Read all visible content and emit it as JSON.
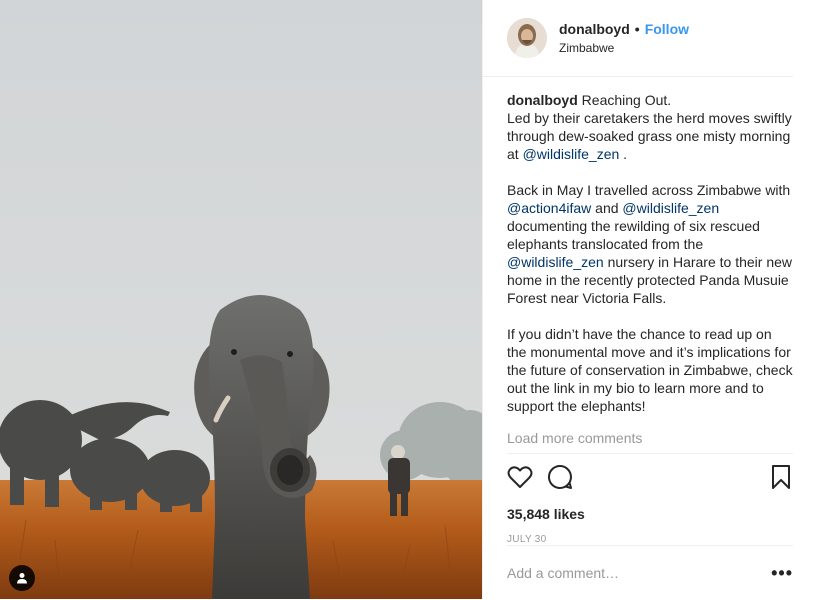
{
  "header": {
    "username": "donalboyd",
    "separator": "•",
    "follow_label": "Follow",
    "location": "Zimbabwe"
  },
  "caption": {
    "username": "donalboyd",
    "p1_a": "Reaching Out.",
    "p1_b": "Led by their caretakers the herd moves swiftly through dew-soaked grass one misty morning at",
    "p1_mention": "@wildislife_zen",
    "p1_end": ".",
    "p2_a": "Back in May I travelled across Zimbabwe with",
    "p2_m1": "@action4ifaw",
    "p2_b": "and",
    "p2_m2": "@wildislife_zen",
    "p2_c": "documenting the rewilding of six rescued elephants translocated from the",
    "p2_m3": "@wildislife_zen",
    "p2_d": "nursery in Harare to their new home in the recently protected Panda Musuie Forest near Victoria Falls.",
    "p3": "If you didn’t have the chance to read up on the monumental move and it’s implications for the future of conservation in Zimbabwe, check out the link in my bio to learn more and to support the elephants!",
    "load_more": "Load more comments"
  },
  "actions": {
    "like_icon": "heart-icon",
    "comment_icon": "comment-icon",
    "save_icon": "bookmark-icon",
    "likes": "35,848 likes",
    "date": "JULY 30"
  },
  "comment": {
    "placeholder": "Add a comment…",
    "more_label": "•••"
  },
  "colors": {
    "link": "#3897f0",
    "mention": "#003569",
    "muted": "#999999",
    "grass": "#b8631e",
    "sky": "#d3d6d8"
  }
}
